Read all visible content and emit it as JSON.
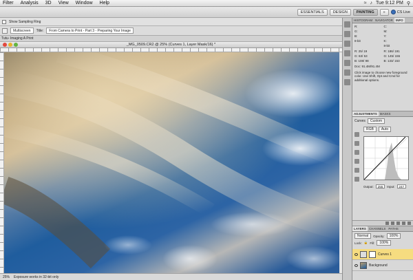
{
  "menubar": {
    "items": [
      "Filter",
      "Analysis",
      "3D",
      "View",
      "Window",
      "Help"
    ],
    "status": {
      "clock": "Tue 9:12 PM"
    }
  },
  "appbar": {
    "workspaces": [
      "ESSENTIALS",
      "DESIGN",
      "PAINTING"
    ],
    "active": "PAINTING",
    "cs_live": "CS Live"
  },
  "options": {
    "show_sampling_ring": "Show Sampling Ring",
    "multiscreen": "Multiscreen",
    "title_label": "Title:",
    "title_value": "From Camera to Print - Part 3 - Preparing Your Image",
    "tab_label": "Tutu- Imaging A Print"
  },
  "document": {
    "title": "_MG_0509.CR2 @ 25% (Curves 1, Layer Mask/16) *",
    "zoom": "25%",
    "status_text": "Exposure works in 32-bit only"
  },
  "info_panel": {
    "tabs": [
      "HISTOGRAM",
      "NAVIGATOR",
      "INFO"
    ],
    "active": "INFO",
    "rgb_left": [
      "R:",
      "G:",
      "B:"
    ],
    "rgb_right": [
      "C:",
      "M:",
      "Y:",
      "K:"
    ],
    "bit_left": "8-bit",
    "bit_right": "8-bit",
    "rows_left": [
      [
        "R:",
        "25/",
        "19"
      ],
      [
        "G:",
        "63/",
        "53"
      ],
      [
        "B:",
        "108/",
        "98"
      ]
    ],
    "rows_right": [
      [
        "R:",
        "186/",
        "191"
      ],
      [
        "G:",
        "145/",
        "155"
      ],
      [
        "B:",
        "133/",
        "153"
      ]
    ],
    "doc": "Doc: 91.4M/91.4M",
    "hint": "Click image to choose new foreground color. Use Shift, Opt and Cmd for additional options."
  },
  "adjustments": {
    "tabs": [
      "ADJUSTMENTS",
      "MASKS"
    ],
    "active": "ADJUSTMENTS",
    "type_label": "Curves",
    "preset": "Custom",
    "channel": "RGB",
    "auto_label": "Auto",
    "output_label": "Output:",
    "output_value": "255",
    "input_label": "Input:",
    "input_value": "247"
  },
  "layers": {
    "tabs": [
      "LAYERS",
      "CHANNELS",
      "PATHS"
    ],
    "active": "LAYERS",
    "blend_mode": "Normal",
    "opacity_label": "Opacity:",
    "opacity_value": "100%",
    "lock_label": "Lock:",
    "fill_label": "Fill:",
    "fill_value": "100%",
    "items": [
      {
        "name": "Curves 1"
      },
      {
        "name": "Background"
      }
    ]
  },
  "colors": {
    "selected_layer": "#f6dc80",
    "accent": "#3b6fb8"
  }
}
